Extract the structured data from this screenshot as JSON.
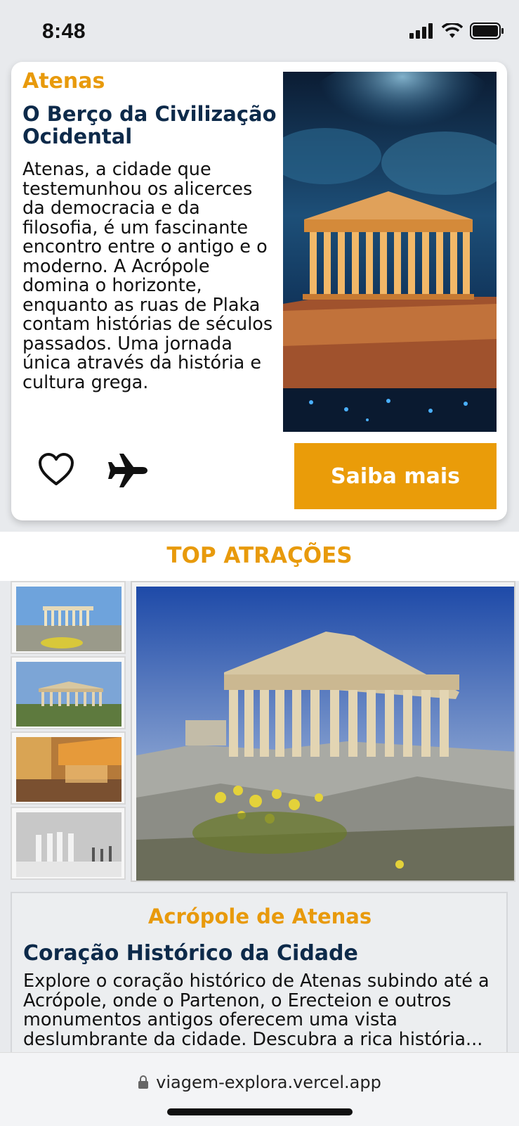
{
  "status_bar": {
    "time": "8:48"
  },
  "hero": {
    "city": "Atenas",
    "headline": "O Berço da Civilização Ocidental",
    "description": "Atenas, a cidade que testemunhou os alicerces da democracia e da filosofia, é um fascinante encontro entre o antigo e o moderno. A Acrópole domina o horizonte, enquanto as ruas de Plaka contam histórias de séculos passados. Uma jornada única através da história e cultura grega.",
    "cta_label": "Saiba mais",
    "icons": [
      "heart-icon",
      "airplane-icon"
    ]
  },
  "attractions": {
    "section_title": "TOP ATRAÇÕES",
    "thumbnails": [
      "parthenon-day",
      "temple-hephaestus",
      "plaka-street-night",
      "acropolis-museum-caryatids"
    ],
    "selected": {
      "name": "Acrópole de Atenas",
      "subtitle": "Coração Histórico da Cidade",
      "description": "Explore o coração histórico de Atenas subindo até a Acrópole, onde o Partenon, o Erecteion e outros monumentos antigos oferecem uma vista deslumbrante da cidade. Descubra a rica história..."
    }
  },
  "browser": {
    "url": "viagem-explora.vercel.app"
  },
  "colors": {
    "accent": "#ea9c09",
    "navy": "#0d2a4a"
  }
}
